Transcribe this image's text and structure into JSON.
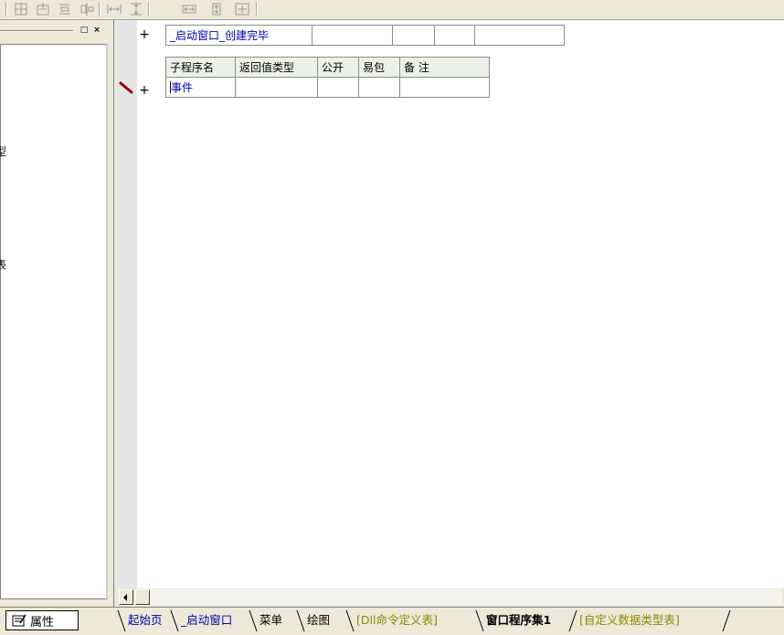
{
  "toolbar": {
    "buttons": [
      "align-left-icon",
      "align-center-icon",
      "align-right-icon",
      "align-top-icon",
      "distribute-h-icon",
      "distribute-v-icon",
      "same-width-icon",
      "same-height-icon",
      "same-size-icon"
    ]
  },
  "left_panel": {
    "fragments": [
      "型",
      "表"
    ],
    "buttons": {
      "restore": "□",
      "close": "×"
    }
  },
  "editor": {
    "program_set_row": {
      "plus": "+",
      "name": "_启动窗口_创建完毕"
    },
    "sub_table": {
      "headers": [
        "子程序名",
        "返回值类型",
        "公开",
        "易包",
        "备 注"
      ],
      "row": {
        "plus": "+",
        "name": "事件"
      }
    }
  },
  "bottom": {
    "properties_label": "属性",
    "tabs": [
      {
        "label": "起始页",
        "color": "#0000b0",
        "active": false
      },
      {
        "label": "_启动窗口",
        "color": "#0000b0",
        "active": false
      },
      {
        "label": "菜单",
        "color": "#000000",
        "active": false
      },
      {
        "label": "绘图",
        "color": "#000000",
        "active": false
      },
      {
        "label": "[Dll命令定义表]",
        "color": "#8a8a00",
        "active": false
      },
      {
        "label": "窗口程序集1",
        "color": "#000000",
        "active": true
      },
      {
        "label": "[自定义数据类型表]",
        "color": "#8a8a00",
        "active": false
      }
    ]
  }
}
